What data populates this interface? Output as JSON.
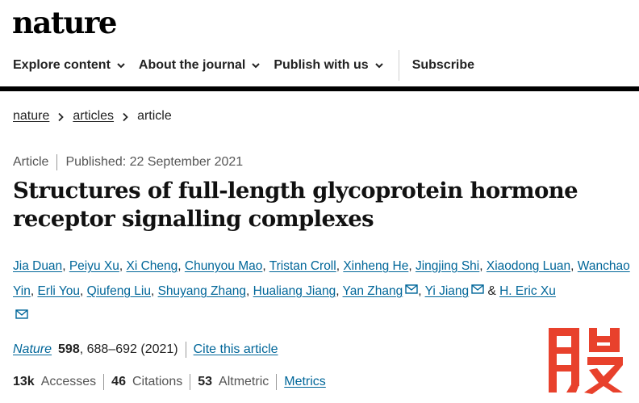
{
  "brand": {
    "logo_text": "nature"
  },
  "nav": {
    "items": [
      {
        "label": "Explore content"
      },
      {
        "label": "About the journal"
      },
      {
        "label": "Publish with us"
      }
    ],
    "subscribe": "Subscribe"
  },
  "breadcrumb": {
    "items": [
      "nature",
      "articles"
    ],
    "current": "article"
  },
  "meta": {
    "type": "Article",
    "published": "Published: 22 September 2021"
  },
  "article": {
    "title": "Structures of full-length glycoprotein hormone receptor signalling complexes"
  },
  "authors": [
    "Jia Duan",
    "Peiyu Xu",
    "Xi Cheng",
    "Chunyou Mao",
    "Tristan Croll",
    "Xinheng He",
    "Jingjing Shi",
    "Xiaodong Luan",
    "Wanchao Yin",
    "Erli You",
    "Qiufeng Liu",
    "Shuyang Zhang",
    "Hualiang Jiang",
    "Yan Zhang",
    "Yi Jiang",
    "H. Eric Xu"
  ],
  "authors_connector": "&",
  "citation": {
    "journal": "Nature",
    "volume": "598",
    "pages": ", 688–692 (2021)",
    "cite_link": "Cite this article"
  },
  "metrics": {
    "accesses_value": "13k",
    "accesses_label": "Accesses",
    "citations_value": "46",
    "citations_label": "Citations",
    "altmetric_value": "53",
    "altmetric_label": "Altmetric",
    "link": "Metrics"
  },
  "colors": {
    "link": "#006699",
    "watermark": "#e8412c"
  },
  "watermark": {
    "glyph": "股"
  }
}
